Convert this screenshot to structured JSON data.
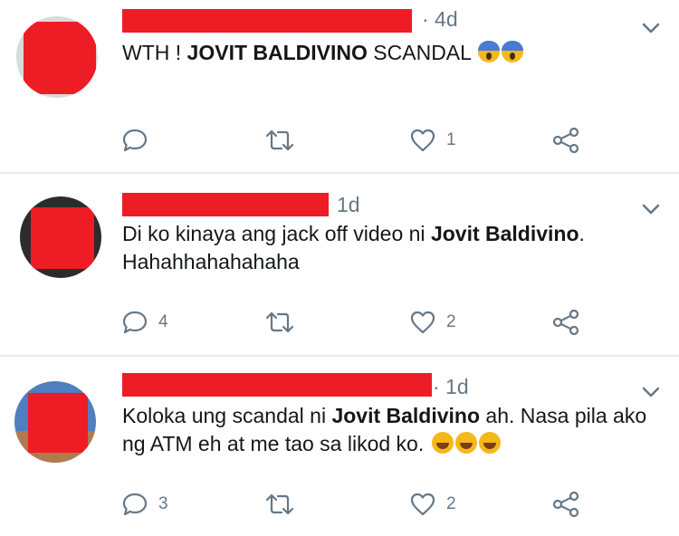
{
  "tweets": [
    {
      "time": "· 4d",
      "body_pre": "WTH ! ",
      "body_bold": "JOVIT BALDIVINO",
      "body_post": " SCANDAL",
      "emojis": [
        "scream-icon",
        "scream-icon"
      ],
      "reply_count": "",
      "like_count": "1"
    },
    {
      "time": "1d",
      "body_pre": "Di ko kinaya ang jack off video ni ",
      "body_bold": "Jovit Baldivino",
      "body_post": ".",
      "line2": "Hahahhahahahaha",
      "reply_count": "4",
      "like_count": "2"
    },
    {
      "time": "· 1d",
      "body_pre": "Koloka ung scandal ni ",
      "body_bold": "Jovit Baldivino",
      "body_post": " ah. Nasa pila ako",
      "line2": "ng ATM eh at me tao sa likod ko.",
      "emojis": [
        "rofl-icon",
        "rofl-icon",
        "rofl-icon"
      ],
      "reply_count": "3",
      "like_count": "2"
    }
  ],
  "colors": {
    "redaction": "#ee1c25",
    "muted": "#657786",
    "divider": "#e6ecf0"
  }
}
